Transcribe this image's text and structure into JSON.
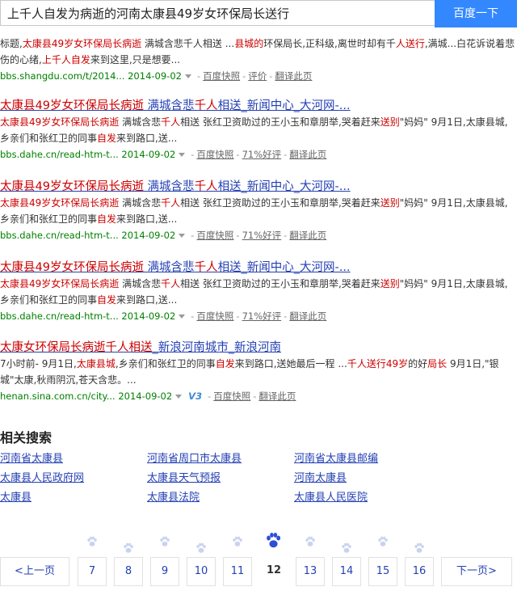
{
  "search": {
    "query": "上千人自发为病逝的河南太康县49岁女环保局长送行",
    "button_label": "百度一下"
  },
  "results": [
    {
      "title": [],
      "abstract": [
        {
          "t": "标题,",
          "h": false
        },
        {
          "t": "太康县49岁女环保局长病逝",
          "h": true
        },
        {
          "t": " 满城含悲千人相送 ...",
          "h": false
        },
        {
          "t": "县城的",
          "h": true
        },
        {
          "t": "环保局长,正科级,离世时却有千",
          "h": false
        },
        {
          "t": "人送行",
          "h": true
        },
        {
          "t": ",满城...白花诉说着悲伤的心绪,",
          "h": false
        },
        {
          "t": "上千人自发",
          "h": true
        },
        {
          "t": "来到这里,只是想要...",
          "h": false
        }
      ],
      "url": "bbs.shangdu.com/t/2014...",
      "date": "2014-09-02",
      "links": [
        "百度快照",
        "评价",
        "翻译此页"
      ]
    },
    {
      "title": [
        {
          "t": "太康县49岁女环保局长病逝",
          "h": true
        },
        {
          "t": " 满城含悲",
          "h": false
        },
        {
          "t": "千人",
          "h": true
        },
        {
          "t": "相送_新闻中心_大河网-...",
          "h": false
        }
      ],
      "abstract": [
        {
          "t": "太康县49岁女环保局长病逝",
          "h": true
        },
        {
          "t": " 满城含悲",
          "h": false
        },
        {
          "t": "千人",
          "h": true
        },
        {
          "t": "相送 张红卫资助过的王小玉和章朋举,哭着赶来",
          "h": false
        },
        {
          "t": "送别",
          "h": true
        },
        {
          "t": "\"妈妈\" 9月1日,太康县城,乡亲们和张红卫的同事",
          "h": false
        },
        {
          "t": "自发",
          "h": true
        },
        {
          "t": "来到路口,送...",
          "h": false
        }
      ],
      "url": "bbs.dahe.cn/read-htm-t...",
      "date": "2014-09-02",
      "links": [
        "百度快照",
        "71%好评",
        "翻译此页"
      ]
    },
    {
      "title": [
        {
          "t": "太康县49岁女环保局长病逝",
          "h": true
        },
        {
          "t": " 满城含悲",
          "h": false
        },
        {
          "t": "千人",
          "h": true
        },
        {
          "t": "相送_新闻中心_大河网-...",
          "h": false
        }
      ],
      "abstract": [
        {
          "t": "太康县49岁女环保局长病逝",
          "h": true
        },
        {
          "t": " 满城含悲",
          "h": false
        },
        {
          "t": "千人",
          "h": true
        },
        {
          "t": "相送 张红卫资助过的王小玉和章朋举,哭着赶来",
          "h": false
        },
        {
          "t": "送别",
          "h": true
        },
        {
          "t": "\"妈妈\" 9月1日,太康县城,乡亲们和张红卫的同事",
          "h": false
        },
        {
          "t": "自发",
          "h": true
        },
        {
          "t": "来到路口,送...",
          "h": false
        }
      ],
      "url": "bbs.dahe.cn/read-htm-t...",
      "date": "2014-09-02",
      "links": [
        "百度快照",
        "71%好评",
        "翻译此页"
      ]
    },
    {
      "title": [
        {
          "t": "太康县49岁女环保局长病逝",
          "h": true
        },
        {
          "t": " 满城含悲",
          "h": false
        },
        {
          "t": "千人",
          "h": true
        },
        {
          "t": "相送_新闻中心_大河网-...",
          "h": false
        }
      ],
      "abstract": [
        {
          "t": "太康县49岁女环保局长病逝",
          "h": true
        },
        {
          "t": " 满城含悲",
          "h": false
        },
        {
          "t": "千人",
          "h": true
        },
        {
          "t": "相送 张红卫资助过的王小玉和章朋举,哭着赶来",
          "h": false
        },
        {
          "t": "送别",
          "h": true
        },
        {
          "t": "\"妈妈\" 9月1日,太康县城,乡亲们和张红卫的同事",
          "h": false
        },
        {
          "t": "自发",
          "h": true
        },
        {
          "t": "来到路口,送...",
          "h": false
        }
      ],
      "url": "bbs.dahe.cn/read-htm-t...",
      "date": "2014-09-02",
      "links": [
        "百度快照",
        "71%好评",
        "翻译此页"
      ]
    },
    {
      "title": [
        {
          "t": "太康女环保局长病逝千人相送",
          "h": true
        },
        {
          "t": "_新浪河南城市_新浪河南",
          "h": false
        }
      ],
      "abstract": [
        {
          "t": "7小时前- 9月1日,",
          "h": false
        },
        {
          "t": "太康县城",
          "h": true
        },
        {
          "t": ",乡亲们和张红卫的同事",
          "h": false
        },
        {
          "t": "自发",
          "h": true
        },
        {
          "t": "来到路口,送她最后一程 ...",
          "h": false
        },
        {
          "t": "千人送行49",
          "h": true
        },
        {
          "t": "岁",
          "h": true
        },
        {
          "t": "的好",
          "h": false
        },
        {
          "t": "局长",
          "h": true
        },
        {
          "t": " 9月1日,\"银城\"太康,秋雨阴沉,苍天含悲。...",
          "h": false
        }
      ],
      "url": "henan.sina.com.cn/city...",
      "date": "2014-09-02",
      "badge": "V3",
      "links": [
        "百度快照",
        "翻译此页"
      ]
    }
  ],
  "related": {
    "title": "相关搜索",
    "items": [
      "河南省太康县",
      "河南省周口市太康县",
      "河南省太康县邮编",
      "太康县人民政府网",
      "太康县天气预报",
      "河南太康县",
      "太康县",
      "太康县法院",
      "太康县人民医院"
    ]
  },
  "pager": {
    "prev": "<上一页",
    "pages": [
      "7",
      "8",
      "9",
      "10",
      "11",
      "12",
      "13",
      "14",
      "15",
      "16"
    ],
    "current": "12",
    "next": "下一页>",
    "logo_text": "du"
  },
  "colors": {
    "link": "#2440b3",
    "highlight": "#cc0000",
    "url": "#008000",
    "button": "#3388ff"
  }
}
